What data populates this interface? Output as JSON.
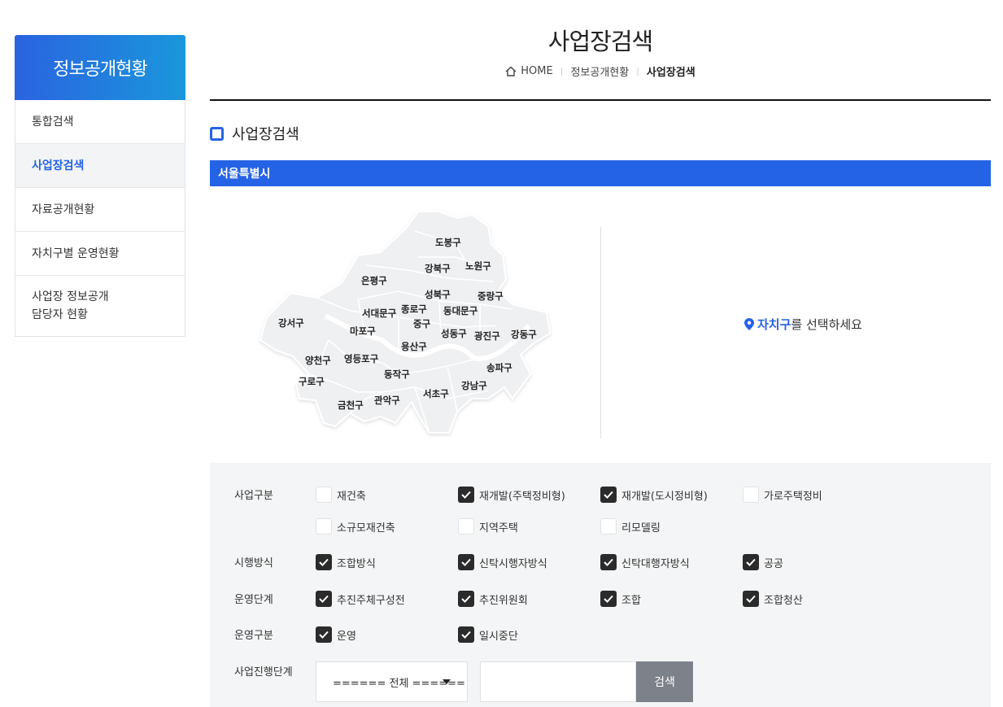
{
  "sidebar": {
    "title": "정보공개현황",
    "items": [
      {
        "label": "통합검색"
      },
      {
        "label": "사업장검색"
      },
      {
        "label": "자료공개현황"
      },
      {
        "label": "자치구별 운영현황"
      },
      {
        "label": "사업장 정보공개\n담당자 현황"
      }
    ]
  },
  "header": {
    "title": "사업장검색",
    "breadcrumb": [
      "HOME",
      "정보공개현황",
      "사업장검색"
    ]
  },
  "section": {
    "title": "사업장검색",
    "city": "서울특별시"
  },
  "map": {
    "districts": [
      "도봉구",
      "강북구",
      "노원구",
      "은평구",
      "성북구",
      "중랑구",
      "종로구",
      "동대문구",
      "서대문구",
      "강서구",
      "마포구",
      "중구",
      "성동구",
      "광진구",
      "강동구",
      "용산구",
      "양천구",
      "영등포구",
      "동작구",
      "송파구",
      "구로구",
      "강남구",
      "서초구",
      "관악구",
      "금천구"
    ]
  },
  "prompt": {
    "highlight": "자치구",
    "rest": "를 선택하세요"
  },
  "filters": {
    "business_type": {
      "label": "사업구분",
      "options": [
        {
          "label": "재건축",
          "checked": false
        },
        {
          "label": "재개발(주택정비형)",
          "checked": true
        },
        {
          "label": "재개발(도시정비형)",
          "checked": true
        },
        {
          "label": "가로주택정비",
          "checked": false
        },
        {
          "label": "소규모재건축",
          "checked": false
        },
        {
          "label": "지역주택",
          "checked": false
        },
        {
          "label": "리모델링",
          "checked": false
        }
      ]
    },
    "method": {
      "label": "시행방식",
      "options": [
        {
          "label": "조합방식",
          "checked": true
        },
        {
          "label": "신탁시행자방식",
          "checked": true
        },
        {
          "label": "신탁대행자방식",
          "checked": true
        },
        {
          "label": "공공",
          "checked": true
        }
      ]
    },
    "stage": {
      "label": "운영단계",
      "options": [
        {
          "label": "추진주체구성전",
          "checked": true
        },
        {
          "label": "추진위원회",
          "checked": true
        },
        {
          "label": "조합",
          "checked": true
        },
        {
          "label": "조합청산",
          "checked": true
        }
      ]
    },
    "operation": {
      "label": "운영구분",
      "options": [
        {
          "label": "운영",
          "checked": true
        },
        {
          "label": "일시중단",
          "checked": true
        }
      ]
    },
    "progress": {
      "label": "사업진행단계",
      "select_value": "====== 전체 ======",
      "search_label": "검색"
    }
  },
  "colors": {
    "accent": "#2563e6",
    "checkbox_on": "#2b2b2b",
    "filter_bg": "#f4f5f6",
    "search_button": "#7d818a"
  }
}
